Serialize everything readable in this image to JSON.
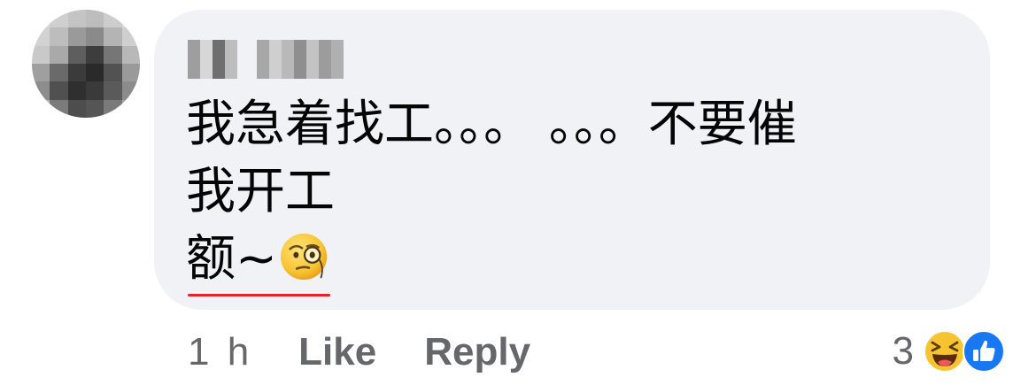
{
  "comment": {
    "author": "",
    "lines": [
      "我急着找工。。。 。。。不要催",
      "我开工",
      "额~"
    ],
    "emoji": "face-with-monocle-icon"
  },
  "actions": {
    "time": "1 h",
    "like_label": "Like",
    "reply_label": "Reply"
  },
  "reactions": {
    "count": "3",
    "icons": [
      "laughing-face-icon",
      "thumbs-up-icon"
    ],
    "colors": {
      "like_blue": "#1877f2",
      "laugh_yellow": "#f7c431"
    }
  },
  "colors": {
    "bubble_bg": "#f0f2f5",
    "text": "#050505",
    "secondary_text": "#65676b",
    "spellcheck_underline": "#e0242a"
  }
}
